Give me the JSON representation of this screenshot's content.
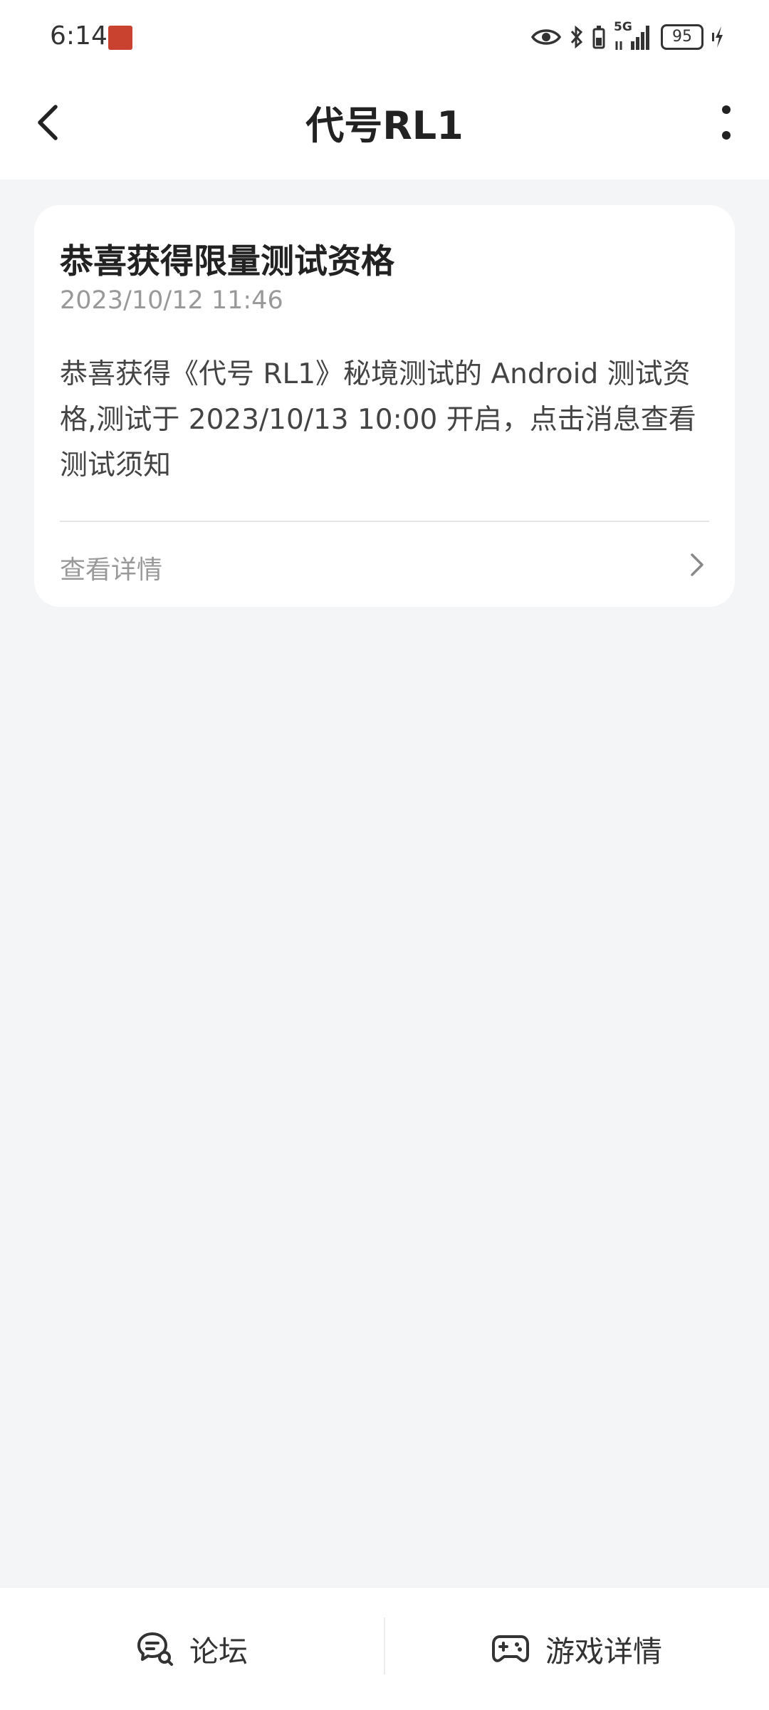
{
  "status_bar": {
    "time": "6:14",
    "battery": "95",
    "network": "5G"
  },
  "header": {
    "title": "代号RL1"
  },
  "message": {
    "title": "恭喜获得限量测试资格",
    "time": "2023/10/12 11:46",
    "body": "恭喜获得《代号 RL1》秘境测试的 Android 测试资格,测试于 2023/10/13 10:00 开启，点击消息查看测试须知",
    "details_label": "查看详情"
  },
  "bottom_bar": {
    "forum_label": "论坛",
    "game_details_label": "游戏详情"
  },
  "icons": {
    "back": "back-arrow-icon",
    "more": "more-vertical-icon",
    "chevron": "chevron-right-icon",
    "forum": "forum-chat-icon",
    "gamepad": "gamepad-icon",
    "eye": "eye-icon",
    "bluetooth": "bluetooth-icon",
    "signal": "signal-icon",
    "charging": "charging-icon"
  }
}
